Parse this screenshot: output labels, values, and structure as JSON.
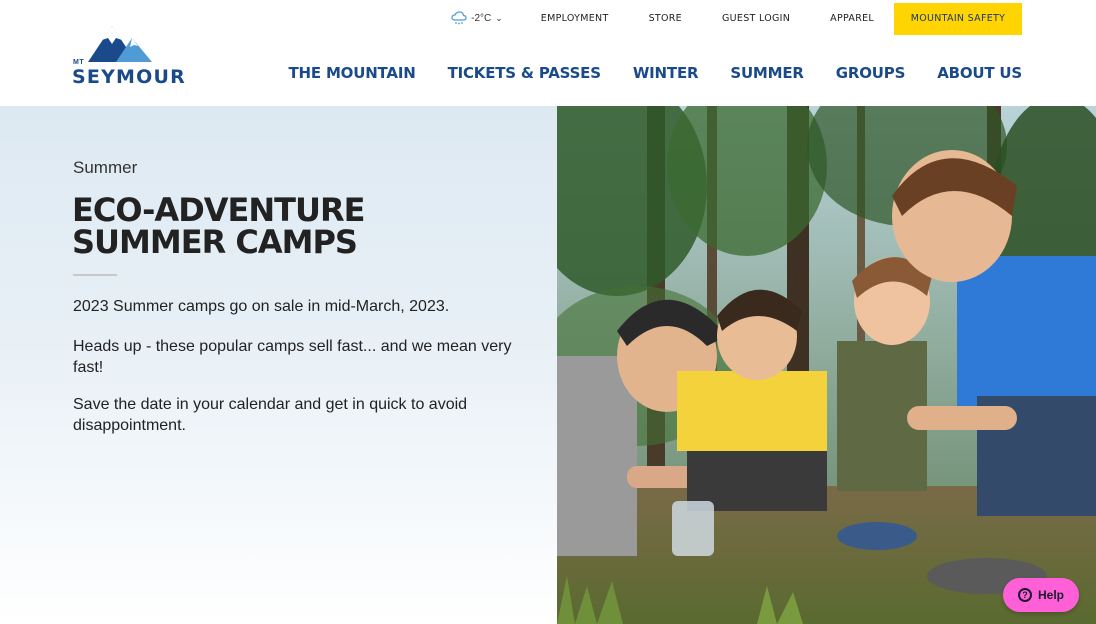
{
  "brand": {
    "prefix": "MT",
    "name": "SEYMOUR"
  },
  "weather": {
    "temperature": "-2°C",
    "icon": "cloud-snow-icon"
  },
  "utility_nav": [
    {
      "label": "EMPLOYMENT"
    },
    {
      "label": "STORE"
    },
    {
      "label": "GUEST LOGIN"
    },
    {
      "label": "APPAREL"
    }
  ],
  "safety_button": {
    "label": "MOUNTAIN SAFETY",
    "color": "#ffd400"
  },
  "main_nav": [
    {
      "label": "THE MOUNTAIN"
    },
    {
      "label": "TICKETS & PASSES"
    },
    {
      "label": "WINTER"
    },
    {
      "label": "SUMMER"
    },
    {
      "label": "GROUPS"
    },
    {
      "label": "ABOUT US"
    }
  ],
  "hero": {
    "eyebrow": "Summer",
    "title_line1": "ECO-ADVENTURE",
    "title_line2": "SUMMER CAMPS",
    "paragraphs": [
      "2023 Summer camps go on sale in mid-March, 2023.",
      "Heads up - these popular camps sell fast... and we mean very fast!",
      "Save the date in your calendar and get in quick to avoid disappointment."
    ]
  },
  "help": {
    "label": "Help",
    "color": "#ff5fd7"
  },
  "colors": {
    "brand_blue": "#1a4a8a",
    "accent_yellow": "#ffd400"
  }
}
